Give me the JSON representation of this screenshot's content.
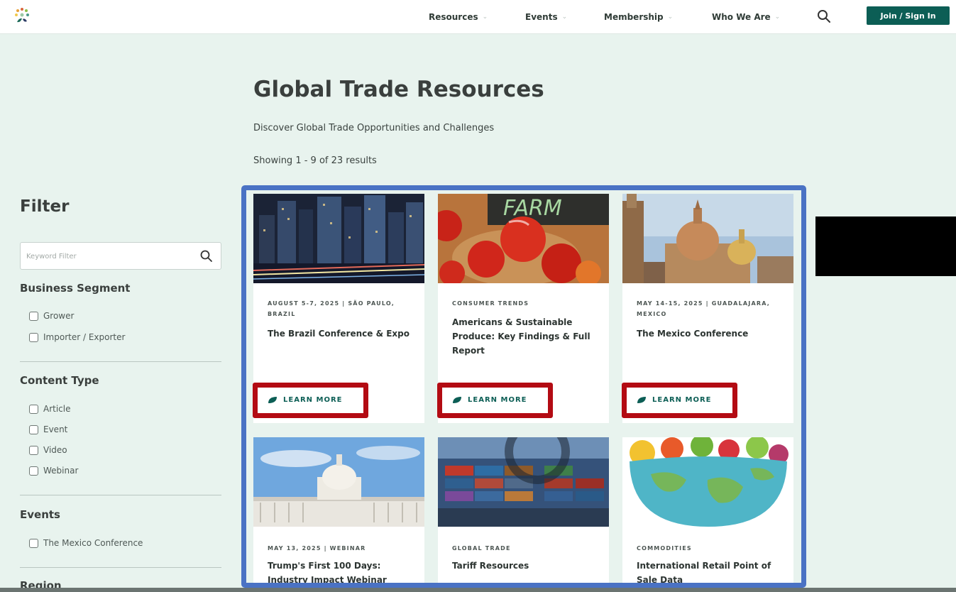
{
  "header": {
    "nav": [
      {
        "label": "Resources"
      },
      {
        "label": "Events"
      },
      {
        "label": "Membership"
      },
      {
        "label": "Who We Are"
      }
    ],
    "join_label": "Join / Sign In"
  },
  "hero": {
    "title": "Global Trade Resources",
    "subtitle": "Discover Global Trade Opportunities and Challenges",
    "results": "Showing 1 - 9 of 23 results"
  },
  "sidebar": {
    "title": "Filter",
    "keyword_placeholder": "Keyword Filter",
    "sections": [
      {
        "title": "Business Segment",
        "options": [
          "Grower",
          "Importer / Exporter"
        ]
      },
      {
        "title": "Content Type",
        "options": [
          "Article",
          "Event",
          "Video",
          "Webinar"
        ]
      },
      {
        "title": "Events",
        "options": [
          "The Mexico Conference"
        ]
      },
      {
        "title": "Region",
        "options": []
      }
    ]
  },
  "cards": [
    {
      "meta": "AUGUST 5-7, 2025 | SÃO PAULO, BRAZIL",
      "title": "The Brazil Conference & Expo",
      "link": "LEARN MORE",
      "image": "city-night-skyline"
    },
    {
      "meta": "CONSUMER TRENDS",
      "title": "Americans & Sustainable Produce: Key Findings & Full Report",
      "link": "LEARN MORE",
      "image": "apples-farm-sign",
      "image_text": "FARM"
    },
    {
      "meta": "MAY 14-15, 2025 | GUADALAJARA, MEXICO",
      "title": "The Mexico Conference",
      "link": "LEARN MORE",
      "image": "cathedral-domes"
    },
    {
      "meta": "MAY 13, 2025 | WEBINAR",
      "title": "Trump's First 100 Days: Industry Impact Webinar",
      "image": "us-capitol"
    },
    {
      "meta": "GLOBAL TRADE",
      "title": "Tariff Resources",
      "image": "shipping-containers"
    },
    {
      "meta": "COMMODITIES",
      "title": "International Retail Point of Sale Data",
      "image": "produce-bowl-globe"
    }
  ],
  "colors": {
    "page_bg": "#e8f3ee",
    "brand": "#0c5e55",
    "highlight_frame": "#4a72c4",
    "highlight_button": "#b30b13"
  }
}
